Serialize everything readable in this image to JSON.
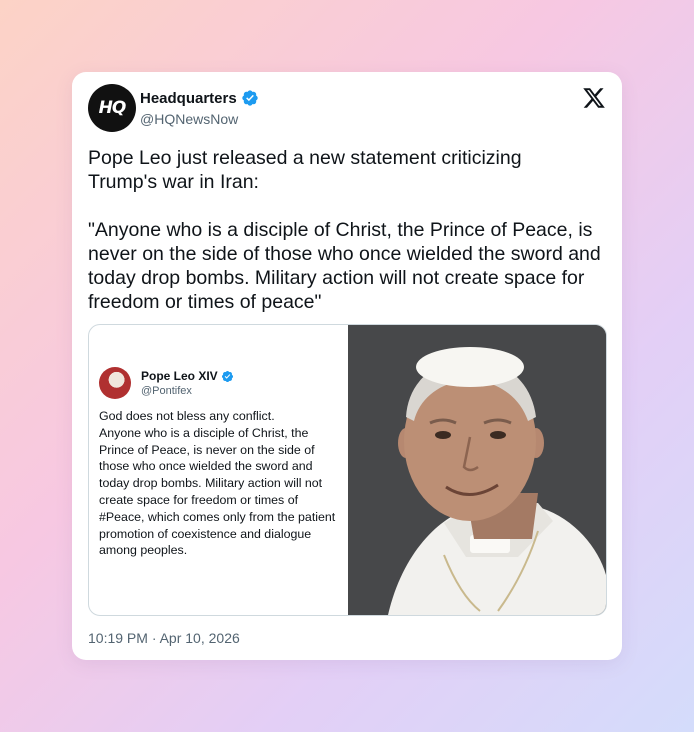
{
  "account": {
    "name": "Headquarters",
    "handle": "@HQNewsNow",
    "avatar_text": "HQ",
    "verified_icon": "verified-badge-icon"
  },
  "tweet": {
    "text": "Pope Leo just released a new statement criticizing\nTrump's war in Iran:\n\n\"Anyone who is a disciple of Christ, the Prince of Peace, is never on the side of those who once wielded the sword and today drop bombs. Military action will not create space for freedom or times of peace\"",
    "timestamp": "10:19 PM · Apr 10, 2026"
  },
  "embedded_post": {
    "name": "Pope Leo XIV",
    "handle": "@Pontifex",
    "text": "God does not bless any conflict.\nAnyone who is a disciple of Christ, the Prince of Peace, is never on the side of those who once wielded the sword and today drop bombs. Military action will not create space for freedom or times of #Peace, which comes only from the patient promotion of coexistence and dialogue among peoples."
  },
  "icons": {
    "platform": "x-logo-icon",
    "verified": "verified-badge-icon"
  },
  "colors": {
    "verified_blue": "#1d9bf0",
    "text_primary": "#0f1419",
    "text_secondary": "#536471"
  }
}
